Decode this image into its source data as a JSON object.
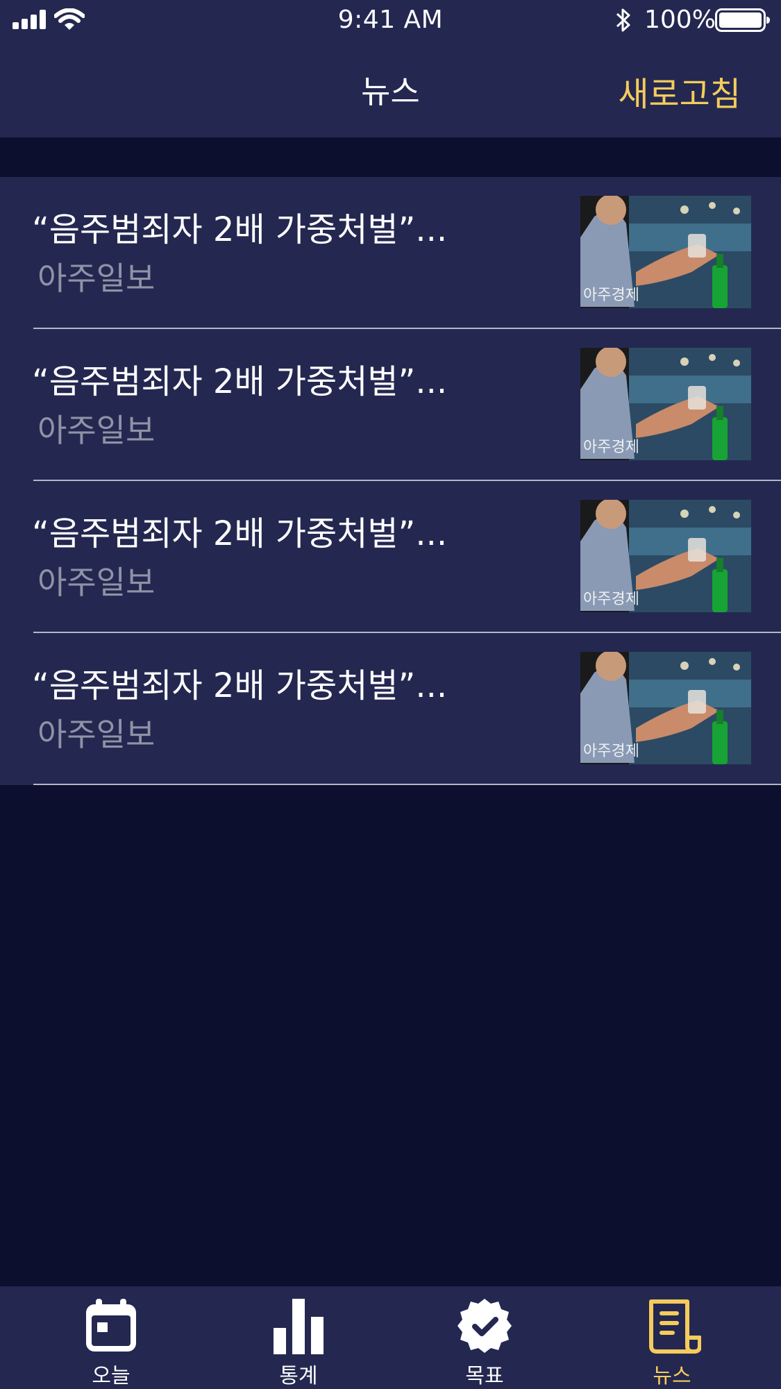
{
  "status_bar": {
    "time": "9:41 AM",
    "battery_percent": "100%"
  },
  "nav": {
    "title": "뉴스",
    "refresh_label": "새로고침"
  },
  "news": [
    {
      "title": "“음주범죄자 2배 가중처벌”...",
      "source": "아주일보",
      "thumb_caption": "아주경제"
    },
    {
      "title": "“음주범죄자 2배 가중처벌”...",
      "source": "아주일보",
      "thumb_caption": "아주경제"
    },
    {
      "title": "“음주범죄자 2배 가중처벌”...",
      "source": "아주일보",
      "thumb_caption": "아주경제"
    },
    {
      "title": "“음주범죄자 2배 가중처벌”...",
      "source": "아주일보",
      "thumb_caption": "아주경제"
    }
  ],
  "tabbar": {
    "tabs": [
      {
        "label": "오늘",
        "icon": "calendar-icon"
      },
      {
        "label": "통계",
        "icon": "bar-chart-icon"
      },
      {
        "label": "목표",
        "icon": "check-badge-icon"
      },
      {
        "label": "뉴스",
        "icon": "newspaper-icon",
        "active": true
      }
    ]
  },
  "colors": {
    "accent": "#f5cc5c",
    "header_bg": "#242850",
    "page_bg": "#0c0f2e",
    "secondary_text": "#8f93a6"
  }
}
